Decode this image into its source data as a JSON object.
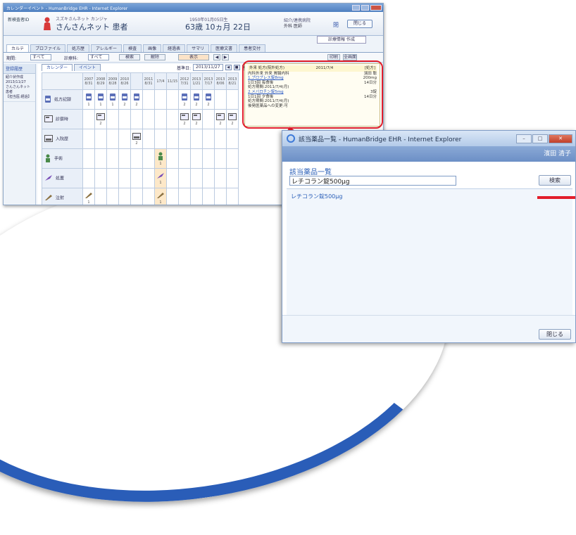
{
  "colors": {
    "accent": "#2a5fb8",
    "highlight_red": "#e21e2b",
    "arc_blue": "#2a5db8"
  },
  "ehr_window": {
    "title": "カレンダーイベント - HumanBridge EHR - Internet Explorer",
    "patient": {
      "id_label": "新検査者ID",
      "kana": "スズキさんネット カンジャ",
      "name": "さんさんネット 患者",
      "dob": "1950年01月05日生",
      "age": "63歳 10ヵ月 22日",
      "doctor_label": "紹介/連携病院",
      "doctor_name": "外科 医師",
      "close_link": "閉",
      "close_button": "閉じる"
    },
    "doc_button": "診療情報 作成",
    "tabs": [
      "カルテ",
      "プロファイル",
      "処方歴",
      "アレルギー",
      "検査",
      "画像",
      "経過表",
      "サマリ",
      "医療文書",
      "患者交付"
    ],
    "filter": {
      "period_label": "期間:",
      "period_value": "すべて",
      "dept_label": "診療科:",
      "dept_value": "すべて",
      "search_button": "検索",
      "clear_button": "解除",
      "show_button": "表示",
      "print_button": "印刷",
      "full_button": "全画面"
    },
    "left_pane": {
      "head": "登録履歴",
      "items": [
        "紹介状作成",
        "2013/11/27",
        "さんさんネット",
        "患者",
        "【担当医:経過】"
      ]
    },
    "sub_tabs": [
      "カレンダー",
      "イベント"
    ],
    "date_ctrl": {
      "label": "基準日:",
      "value": "2013/11/27"
    },
    "grid": {
      "headers": [
        {
          "y": "2007",
          "d": "8/31"
        },
        {
          "y": "2008",
          "d": "8/29"
        },
        {
          "y": "2009",
          "d": "8/28"
        },
        {
          "y": "2010",
          "d": "8/26"
        },
        {
          "y": "",
          "d": ""
        },
        {
          "y": "2011",
          "d": "8/31"
        },
        {
          "y": "",
          "d": "17/4"
        },
        {
          "y": "",
          "d": "11/15"
        },
        {
          "y": "2012",
          "d": "7/31"
        },
        {
          "y": "2013",
          "d": "1/21"
        },
        {
          "y": "2013",
          "d": "7/17"
        },
        {
          "y": "2013",
          "d": "8/06"
        },
        {
          "y": "2013",
          "d": "8/21"
        }
      ],
      "rows": [
        {
          "label": "処方記録",
          "icon": "medication-icon",
          "cells": [
            "1",
            "1",
            "1",
            "2",
            "2",
            "",
            "",
            "",
            "2",
            "2",
            "2",
            "",
            ""
          ]
        },
        {
          "label": "診察時",
          "icon": "exam-icon",
          "cells": [
            "",
            "2",
            "",
            "",
            "",
            "",
            "",
            "",
            "2",
            "2",
            "",
            "2",
            "2"
          ]
        },
        {
          "label": "入院歴",
          "icon": "admission-icon",
          "cells": [
            "",
            "",
            "",
            "",
            "2",
            "",
            "",
            "",
            "",
            "",
            "",
            "",
            ""
          ]
        },
        {
          "label": "手術",
          "icon": "surgery-icon",
          "cells": [
            "",
            "",
            "",
            "",
            "",
            "",
            "1",
            "",
            "",
            "",
            "",
            "",
            ""
          ]
        },
        {
          "label": "処置",
          "icon": "procedure-icon",
          "cells": [
            "",
            "",
            "",
            "",
            "",
            "",
            "1",
            "",
            "",
            "",
            "",
            "",
            ""
          ]
        },
        {
          "label": "注射",
          "icon": "injection-icon",
          "cells": [
            "1",
            "",
            "",
            "",
            "",
            "",
            "1",
            "",
            "",
            "",
            "",
            "",
            ""
          ]
        }
      ]
    },
    "popup": {
      "header_left": "外来 処方(院外処方)",
      "header_date": "2011/7/4",
      "header_right": "[処方]",
      "dept": "内科外来 外来 胃腸内科",
      "doctor": "濱田 聡",
      "drug1": "1.ブロプレス錠8mg",
      "drug1_dose": "200mg",
      "drug1_usage": "1日3回 毎食後",
      "drug1_days": "14日分",
      "drug1_period": "処方期間:2011/7/4(月)",
      "drug2": "2.メバロチン錠5mg",
      "drug2_dose": "3錠",
      "drug2_usage": "1日1回 夕食後",
      "drug2_days": "14日分",
      "drug2_period": "処方期間:2011/7/4(月)",
      "note": "後発医薬品への変更:可"
    }
  },
  "drug_window": {
    "title": "該当薬品一覧 - HumanBridge EHR - Internet Explorer",
    "user": "濱田 清子",
    "heading": "該当薬品一覧",
    "search_value": "レチコラン錠500μg",
    "search_button": "検索",
    "results": [
      "レチコラン錠500μg"
    ],
    "close_button": "閉じる"
  }
}
